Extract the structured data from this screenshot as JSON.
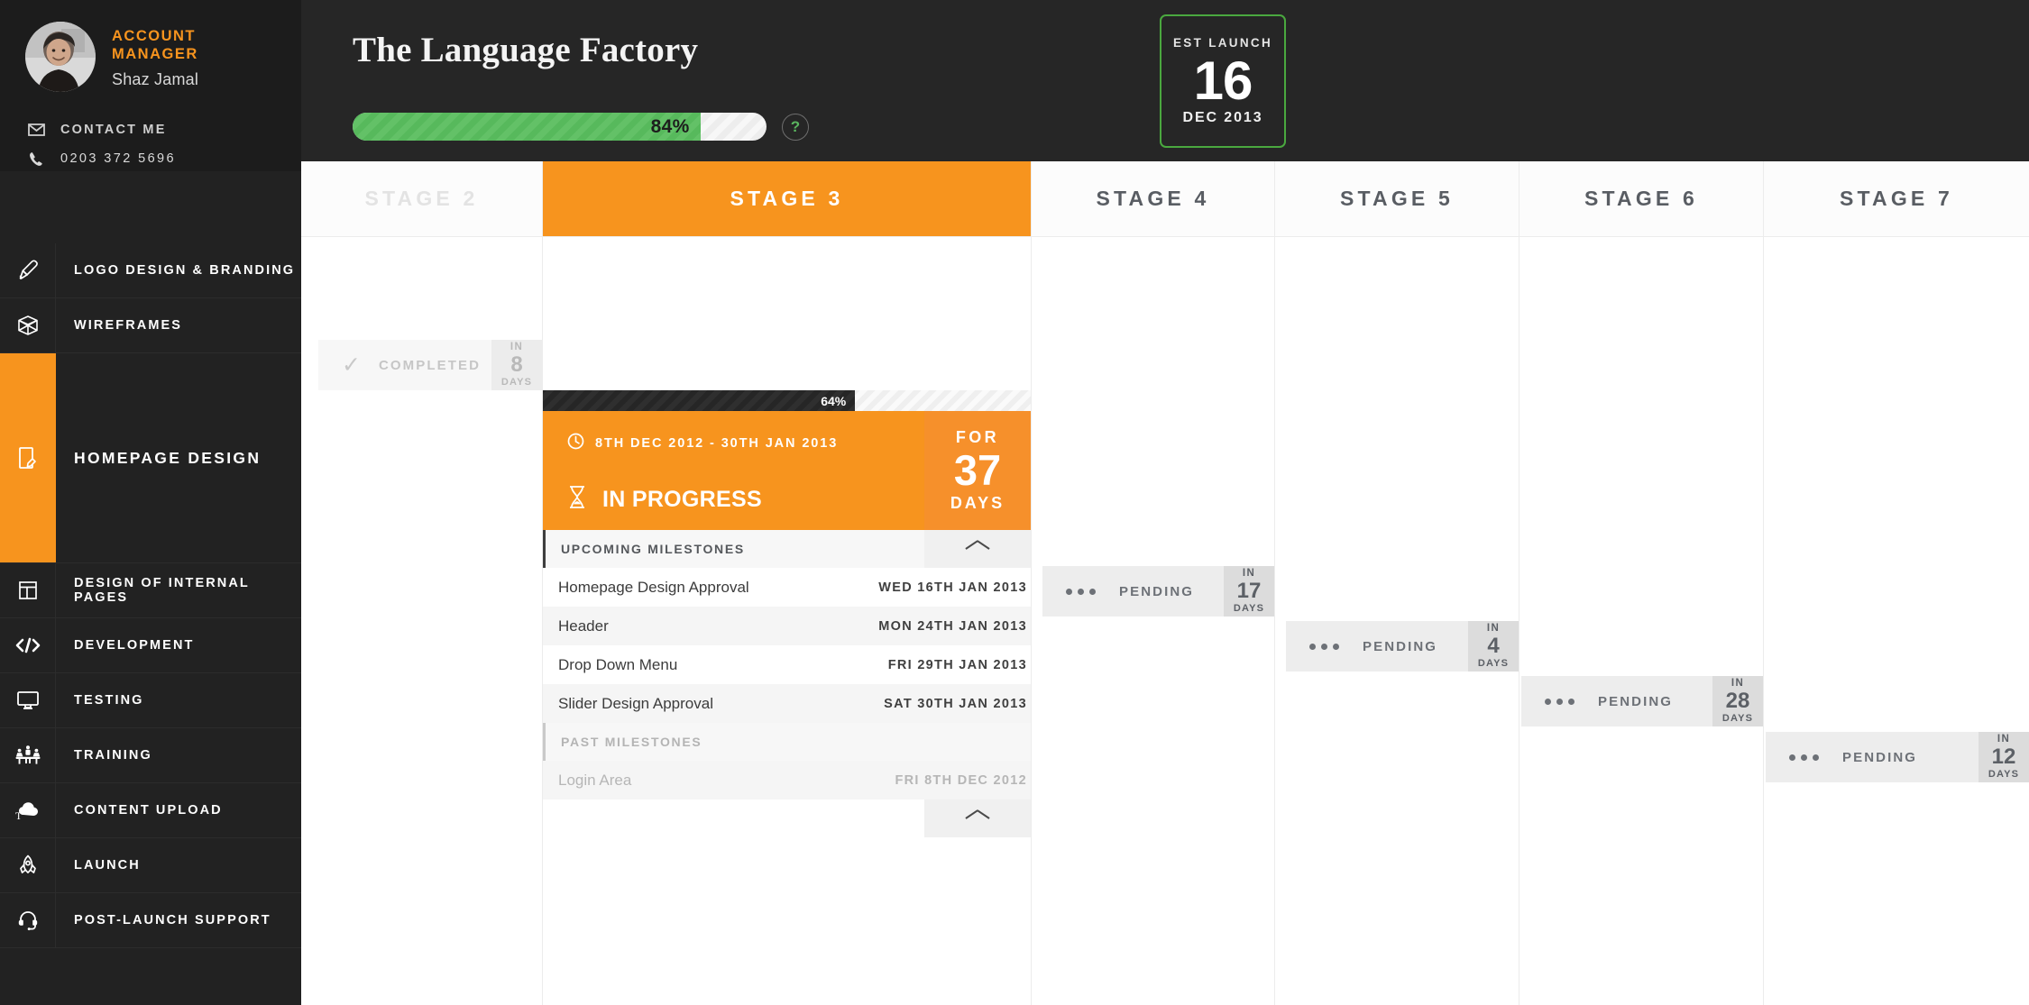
{
  "sidebar": {
    "profile": {
      "role": "ACCOUNT MANAGER",
      "name": "Shaz Jamal",
      "avatar_icon": "user-photo-avatar"
    },
    "contact": [
      {
        "icon": "envelope-icon",
        "label": "CONTACT ME"
      },
      {
        "icon": "phone-icon",
        "label": "0203 372 5696"
      }
    ],
    "nav": [
      {
        "icon": "pen-nib-icon",
        "label": "LOGO DESIGN & BRANDING",
        "active": false
      },
      {
        "icon": "wireframe-cube-icon",
        "label": "WIREFRAMES",
        "active": false
      },
      {
        "icon": "page-design-icon",
        "label": "HOMEPAGE DESIGN",
        "active": true
      },
      {
        "icon": "layout-grid-icon",
        "label": "DESIGN OF INTERNAL PAGES",
        "active": false
      },
      {
        "icon": "code-tags-icon",
        "label": "DEVELOPMENT",
        "active": false
      },
      {
        "icon": "monitor-icon",
        "label": "TESTING",
        "active": false
      },
      {
        "icon": "training-table-icon",
        "label": "TRAINING",
        "active": false
      },
      {
        "icon": "cloud-upload-text-icon",
        "label": "CONTENT UPLOAD",
        "active": false
      },
      {
        "icon": "rocket-icon",
        "label": "LAUNCH",
        "active": false
      },
      {
        "icon": "headset-icon",
        "label": "POST-LAUNCH SUPPORT",
        "active": false
      }
    ]
  },
  "header": {
    "project_title": "The Language Factory",
    "progress": {
      "percent_label": "84%",
      "percent_value": 84
    },
    "help_icon": "question-mark-icon",
    "launch": {
      "caption": "EST  LAUNCH",
      "day": "16",
      "date": "DEC 2013"
    }
  },
  "board": {
    "columns": [
      {
        "name": "STAGE 2",
        "state": "past"
      },
      {
        "name": "STAGE 3",
        "state": "active"
      },
      {
        "name": "STAGE 4",
        "state": "upcoming"
      },
      {
        "name": "STAGE 5",
        "state": "upcoming"
      },
      {
        "name": "STAGE 6",
        "state": "upcoming"
      },
      {
        "name": "STAGE 7",
        "state": "upcoming"
      }
    ],
    "completed_card": {
      "check_icon": "check-mark-icon",
      "label": "COMPLETED",
      "badge": {
        "in": "IN",
        "number": "8",
        "days": "DAYS"
      }
    },
    "active_card": {
      "progress": {
        "percent_label": "64%",
        "percent_value": 64
      },
      "clock_icon": "clock-icon",
      "date_range": "8TH DEC 2012 - 30TH JAN 2013",
      "status_icon": "hourglass-icon",
      "status": "IN PROGRESS",
      "duration": {
        "for": "FOR",
        "number": "37",
        "days": "DAYS"
      },
      "upcoming_header": "UPCOMING MILESTONES",
      "past_header": "PAST MILESTONES",
      "collapse_icon": "chevron-up-icon",
      "upcoming_milestones": [
        {
          "name": "Homepage Design Approval",
          "date": "WED 16TH JAN 2013"
        },
        {
          "name": "Header",
          "date": "MON 24TH JAN 2013"
        },
        {
          "name": "Drop Down Menu",
          "date": "FRI 29TH JAN 2013"
        },
        {
          "name": "Slider Design Approval",
          "date": "SAT 30TH JAN 2013"
        }
      ],
      "past_milestones": [
        {
          "name": "Login Area",
          "date": "FRI 8TH DEC 2012"
        }
      ]
    },
    "pending_cards": [
      {
        "stage": "STAGE 4",
        "dots_icon": "three-dots-icon",
        "label": "PENDING",
        "badge": {
          "in": "IN",
          "number": "17",
          "days": "DAYS"
        }
      },
      {
        "stage": "STAGE 5",
        "dots_icon": "three-dots-icon",
        "label": "PENDING",
        "badge": {
          "in": "IN",
          "number": "4",
          "days": "DAYS"
        }
      },
      {
        "stage": "STAGE 6",
        "dots_icon": "three-dots-icon",
        "label": "PENDING",
        "badge": {
          "in": "IN",
          "number": "28",
          "days": "DAYS"
        }
      },
      {
        "stage": "STAGE 7",
        "dots_icon": "three-dots-icon",
        "label": "PENDING",
        "badge": {
          "in": "IN",
          "number": "12",
          "days": "DAYS"
        }
      }
    ]
  },
  "colors": {
    "accent_orange": "#f7941e",
    "progress_green": "#63c167",
    "launch_border_green": "#4aa83f",
    "sidebar_dark": "#222222",
    "topbar_dark": "#262626"
  }
}
